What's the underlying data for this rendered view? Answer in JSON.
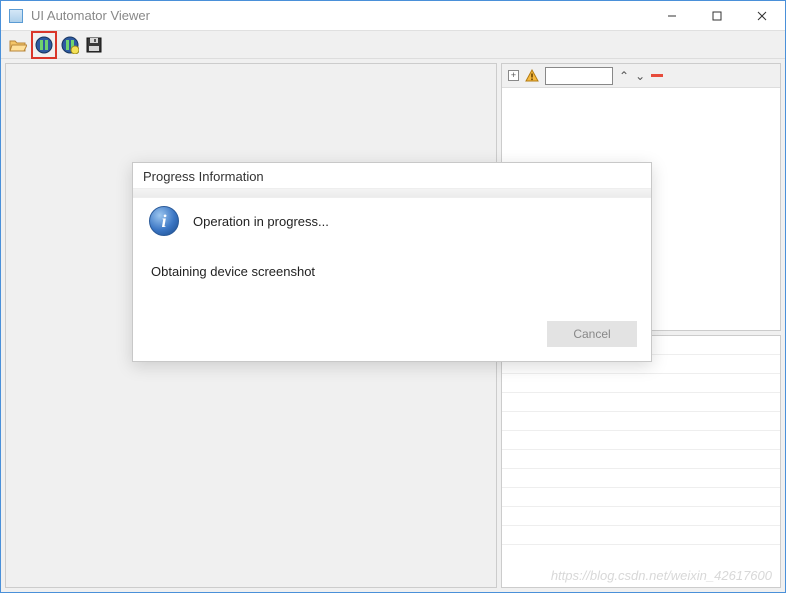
{
  "window": {
    "title": "UI Automator Viewer"
  },
  "toolbar": {
    "open_name": "open-icon",
    "screenshot_a_name": "device-screenshot-icon",
    "screenshot_b_name": "device-screenshot-compressed-icon",
    "save_name": "save-icon"
  },
  "right_panel": {
    "expand_symbol": "+",
    "up_symbol": "⌃",
    "down_symbol": "⌄"
  },
  "dialog": {
    "title": "Progress Information",
    "operation_text": "Operation in progress...",
    "status_text": "Obtaining device screenshot",
    "cancel_label": "Cancel"
  },
  "watermark": "https://blog.csdn.net/weixin_42617600"
}
